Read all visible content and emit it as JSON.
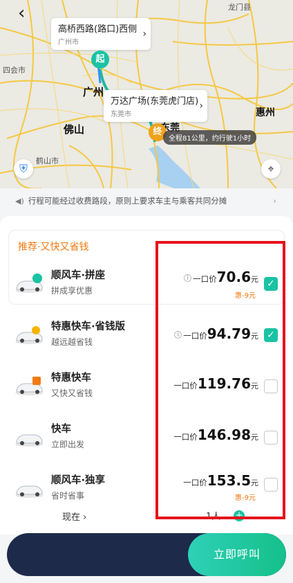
{
  "map": {
    "back_icon": "back-arrow-icon",
    "start_pin": "起",
    "end_pin": "终",
    "start_bubble": {
      "title": "高桥西路(路口)西侧",
      "city": "广州市"
    },
    "end_bubble": {
      "title": "万达广场(东莞虎门店)",
      "city": "东莞市"
    },
    "trip_info": "全程81公里，约行驶1小时",
    "labels": {
      "longmen": "龙门县",
      "sihui": "四会市",
      "guangzhou": "广州",
      "foshan": "佛山",
      "heshan": "鹤山市",
      "dongguan": "东莞",
      "huizhou": "惠州"
    },
    "shield_icon": "shield-icon",
    "locate_icon": "locate-icon"
  },
  "notice": {
    "text": "行程可能经过收费路段，原则上要求车主与乘客共同分摊"
  },
  "recommend": {
    "title": "推荐·又快又省钱"
  },
  "options": [
    {
      "name": "顺风车·拼座",
      "sub": "拼成享优惠",
      "has_info": true,
      "prefix": "一口价",
      "price": "70.6",
      "unit": "元",
      "discount": "惠-9元",
      "checked": true
    },
    {
      "name": "特惠快车·省钱版",
      "sub": "越远越省钱",
      "has_info": true,
      "prefix": "一口价",
      "price": "94.79",
      "unit": "元",
      "discount": "",
      "checked": true
    },
    {
      "name": "特惠快车",
      "sub": "又快又省钱",
      "has_info": false,
      "prefix": "一口价",
      "price": "119.76",
      "unit": "元",
      "discount": "",
      "checked": false
    },
    {
      "name": "快车",
      "sub": "立即出发",
      "has_info": false,
      "prefix": "一口价",
      "price": "146.98",
      "unit": "元",
      "discount": "",
      "checked": false
    },
    {
      "name": "顺风车·独享",
      "sub": "省时省事",
      "has_info": false,
      "prefix": "一口价",
      "price": "153.5",
      "unit": "元",
      "discount": "惠-9元",
      "checked": false
    }
  ],
  "footer": {
    "time": "现在 ›",
    "people": "1人"
  },
  "call_button": "立即呼叫",
  "colors": {
    "accent": "#19c3a3",
    "highlight": "#e5141c",
    "orange": "#f07b12"
  }
}
